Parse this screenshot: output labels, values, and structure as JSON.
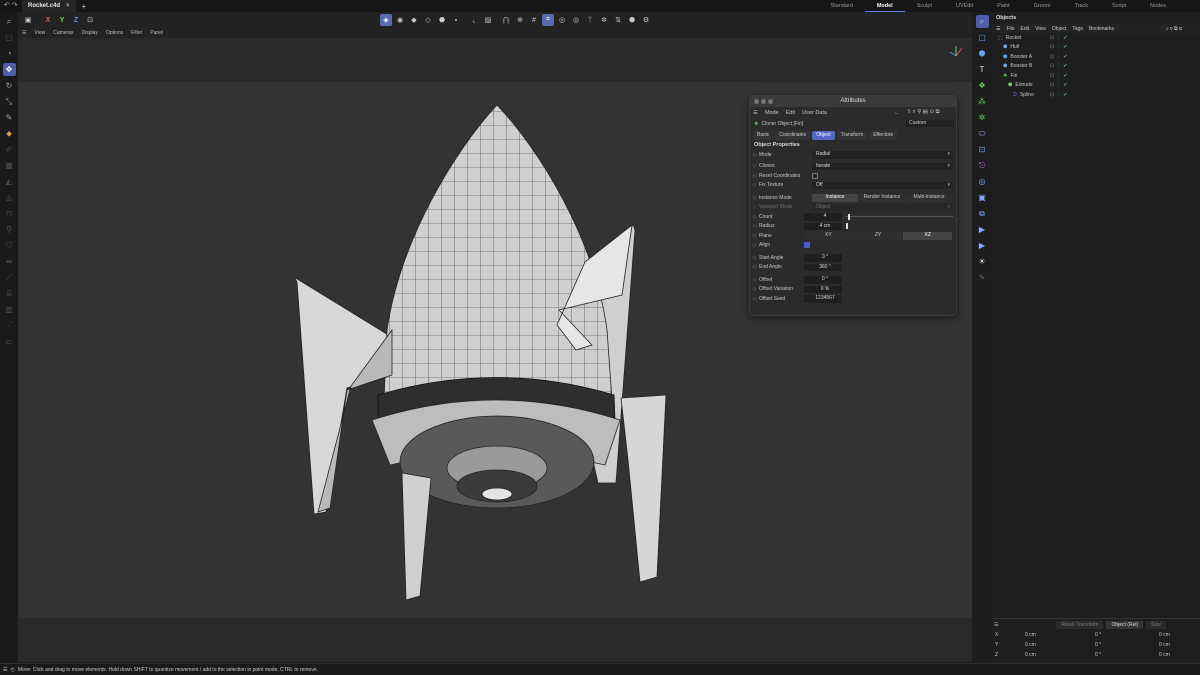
{
  "app": {
    "doc_tab": "Rocket.c4d",
    "layouts": [
      "Standard",
      "Model",
      "Sculpt",
      "UVEdit",
      "Paint",
      "Groom",
      "Track",
      "Script",
      "Nodes"
    ],
    "active_layout": "Model",
    "accent": "#5b6fd6"
  },
  "toolbar": {
    "axis_x": "X",
    "axis_y": "Y",
    "axis_z": "Z"
  },
  "viewport_menu": [
    "View",
    "Cameras",
    "Display",
    "Options",
    "Filter",
    "Panel"
  ],
  "attributes": {
    "title": "Attributes",
    "menu": [
      "Mode",
      "Edit",
      "User Data"
    ],
    "object_name": "Cloner Object [Fin]",
    "preset": "Custom",
    "tabs": [
      "Basic",
      "Coordinates",
      "Object",
      "Transform",
      "Effectors"
    ],
    "active_tab": "Object",
    "section": "Object Properties",
    "mode_label": "Mode",
    "mode_value": "Radial",
    "clones_label": "Clones",
    "clones_value": "Iterate",
    "reset_label": "Reset Coordinates",
    "fix_label": "Fix Texture",
    "fix_value": "Off",
    "instance_label": "Instance Mode",
    "instance_options": [
      "Instance",
      "Render Instance",
      "Multi-Instance"
    ],
    "instance_active": "Instance",
    "viewport_label": "Viewport Mode",
    "viewport_value": "Object",
    "count_label": "Count",
    "count_value": "4",
    "radius_label": "Radius",
    "radius_value": "4 cm",
    "plane_label": "Plane",
    "plane_options": [
      "XY",
      "ZY",
      "XZ"
    ],
    "plane_active": "XZ",
    "align_label": "Align",
    "start_label": "Start Angle",
    "start_value": "0 °",
    "end_label": "End Angle",
    "end_value": "360 °",
    "offset_label": "Offset",
    "offset_value": "0 °",
    "offvar_label": "Offset Variation",
    "offvar_value": "0 %",
    "seed_label": "Offset Seed",
    "seed_value": "1234567"
  },
  "objects": {
    "title": "Objects",
    "menu": [
      "File",
      "Edit",
      "View",
      "Object",
      "Tags",
      "Bookmarks"
    ],
    "items": [
      {
        "name": "Rocket",
        "indent": 0
      },
      {
        "name": "Hull",
        "indent": 1
      },
      {
        "name": "Booster A",
        "indent": 1
      },
      {
        "name": "Booster B",
        "indent": 1
      },
      {
        "name": "Fin",
        "indent": 1
      },
      {
        "name": "Extrude",
        "indent": 2
      },
      {
        "name": "Spline",
        "indent": 3
      }
    ]
  },
  "coordinates": {
    "reset_button": "Reset Transform",
    "space": "Object (Rel)",
    "size_button": "Size",
    "rows": [
      {
        "axis": "X",
        "pos": "0 cm",
        "rot": "0 °",
        "size": "0 cm"
      },
      {
        "axis": "Y",
        "pos": "0 cm",
        "rot": "0 °",
        "size": "0 cm"
      },
      {
        "axis": "Z",
        "pos": "0 cm",
        "rot": "0 °",
        "size": "0 cm"
      }
    ]
  },
  "status": "Move: Click and drag to move elements. Hold down SHIFT to quantize movement / add to the selection in point mode, CTRL to remove."
}
